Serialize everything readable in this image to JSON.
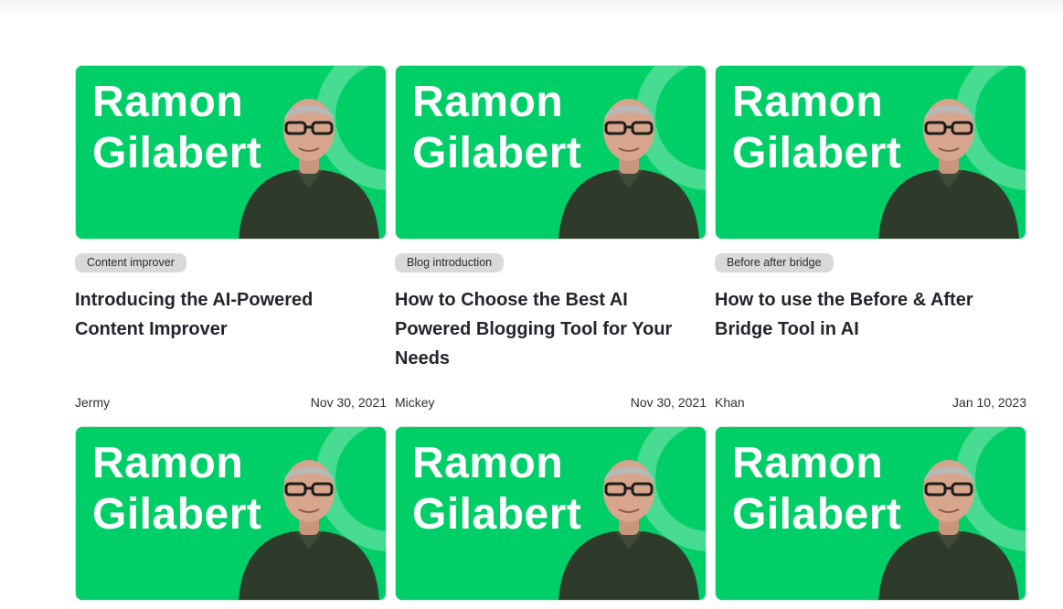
{
  "thumbnail": {
    "name_line1": "Ramon",
    "name_line2": "Gilabert",
    "background_color": "#00cf68"
  },
  "posts": [
    {
      "tag": "Content improver",
      "title": "Introducing the AI-Powered Content Improver",
      "author": "Jermy",
      "date": "Nov 30, 2021"
    },
    {
      "tag": "Blog introduction",
      "title": "How to Choose the Best AI Powered Blogging Tool for Your Needs",
      "author": "Mickey",
      "date": "Nov 30, 2021"
    },
    {
      "tag": "Before after bridge",
      "title": "How to use the Before & After Bridge Tool in AI",
      "author": "Khan",
      "date": "Jan 10, 2023"
    }
  ]
}
